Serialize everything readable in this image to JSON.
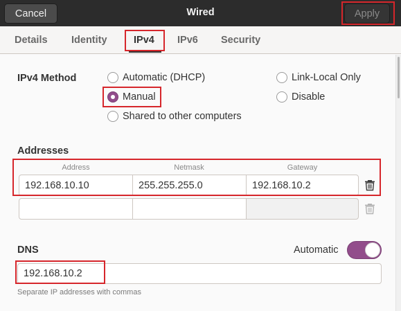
{
  "header": {
    "cancel_label": "Cancel",
    "title": "Wired",
    "apply_label": "Apply"
  },
  "tabs": [
    {
      "label": "Details",
      "active": false
    },
    {
      "label": "Identity",
      "active": false
    },
    {
      "label": "IPv4",
      "active": true
    },
    {
      "label": "IPv6",
      "active": false
    },
    {
      "label": "Security",
      "active": false
    }
  ],
  "ipv4": {
    "method_label": "IPv4 Method",
    "methods": [
      {
        "label": "Automatic (DHCP)",
        "selected": false
      },
      {
        "label": "Manual",
        "selected": true
      },
      {
        "label": "Shared to other computers",
        "selected": false
      },
      {
        "label": "Link-Local Only",
        "selected": false
      },
      {
        "label": "Disable",
        "selected": false
      }
    ]
  },
  "addresses": {
    "heading": "Addresses",
    "columns": [
      "Address",
      "Netmask",
      "Gateway"
    ],
    "rows": [
      [
        "192.168.10.10",
        "255.255.255.0",
        "192.168.10.2"
      ],
      [
        "",
        "",
        ""
      ]
    ]
  },
  "dns": {
    "heading": "DNS",
    "automatic_label": "Automatic",
    "automatic_on": true,
    "value": "192.168.10.2",
    "hint": "Separate IP addresses with commas"
  },
  "colors": {
    "accent": "#924d8b",
    "highlight": "#d6262b",
    "headerbar": "#2c2c2c"
  },
  "icons": [
    "trash-icon"
  ]
}
